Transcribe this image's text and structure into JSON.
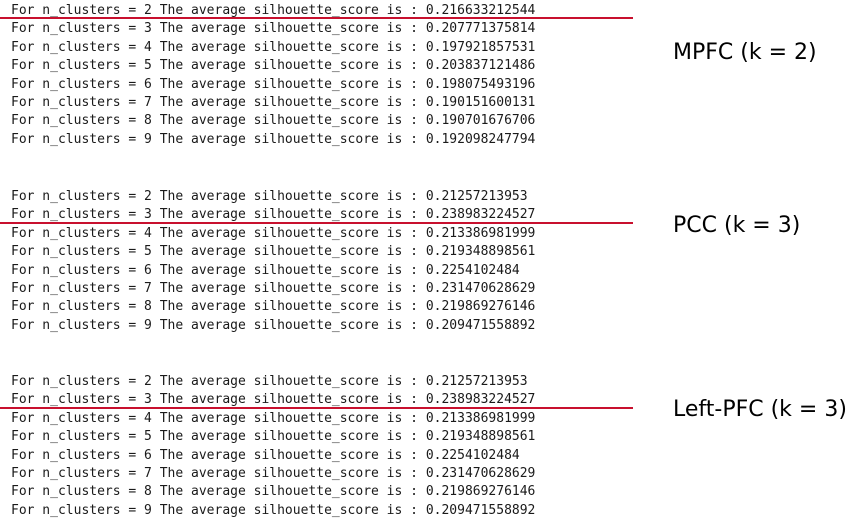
{
  "underline_color": "#c8102e",
  "blocks": [
    {
      "label": "MPFC (k = 2)",
      "lines": [
        "For n_clusters = 2 The average silhouette_score is : 0.216633212544",
        "For n_clusters = 3 The average silhouette_score is : 0.207771375814",
        "For n_clusters = 4 The average silhouette_score is : 0.197921857531",
        "For n_clusters = 5 The average silhouette_score is : 0.203837121486",
        "For n_clusters = 6 The average silhouette_score is : 0.198075493196",
        "For n_clusters = 7 The average silhouette_score is : 0.190151600131",
        "For n_clusters = 8 The average silhouette_score is : 0.190701676706",
        "For n_clusters = 9 The average silhouette_score is : 0.192098247794"
      ],
      "highlighted_line": 0
    },
    {
      "label": "PCC (k = 3)",
      "lines": [
        "For n_clusters = 2 The average silhouette_score is : 0.21257213953",
        "For n_clusters = 3 The average silhouette_score is : 0.238983224527",
        "For n_clusters = 4 The average silhouette_score is : 0.213386981999",
        "For n_clusters = 5 The average silhouette_score is : 0.219348898561",
        "For n_clusters = 6 The average silhouette_score is : 0.2254102484",
        "For n_clusters = 7 The average silhouette_score is : 0.231470628629",
        "For n_clusters = 8 The average silhouette_score is : 0.219869276146",
        "For n_clusters = 9 The average silhouette_score is : 0.209471558892"
      ],
      "highlighted_line": 1
    },
    {
      "label": "Left-PFC (k = 3)",
      "lines": [
        "For n_clusters = 2 The average silhouette_score is : 0.21257213953",
        "For n_clusters = 3 The average silhouette_score is : 0.238983224527",
        "For n_clusters = 4 The average silhouette_score is : 0.213386981999",
        "For n_clusters = 5 The average silhouette_score is : 0.219348898561",
        "For n_clusters = 6 The average silhouette_score is : 0.2254102484",
        "For n_clusters = 7 The average silhouette_score is : 0.231470628629",
        "For n_clusters = 8 The average silhouette_score is : 0.219869276146",
        "For n_clusters = 9 The average silhouette_score is : 0.209471558892"
      ],
      "highlighted_line": 1
    }
  ]
}
